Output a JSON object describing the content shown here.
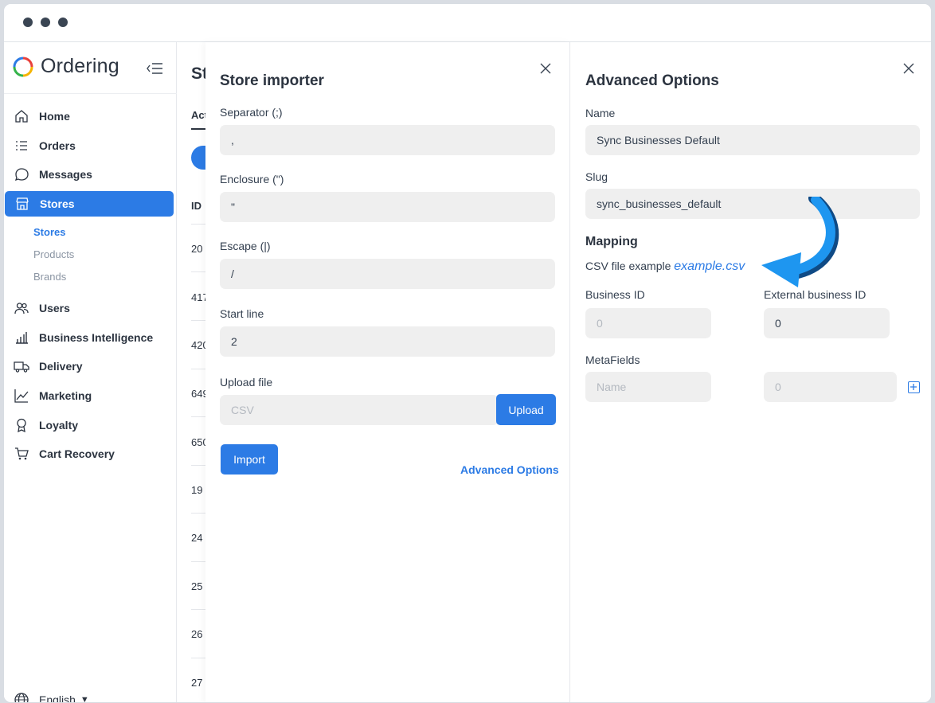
{
  "app": {
    "name": "Ordering"
  },
  "sidebar": {
    "items": [
      {
        "label": "Home",
        "icon": "home-icon"
      },
      {
        "label": "Orders",
        "icon": "list-icon"
      },
      {
        "label": "Messages",
        "icon": "chat-icon"
      },
      {
        "label": "Stores",
        "icon": "store-icon",
        "active": true
      },
      {
        "label": "Users",
        "icon": "users-icon"
      },
      {
        "label": "Business Intelligence",
        "icon": "bar-chart-icon"
      },
      {
        "label": "Delivery",
        "icon": "truck-icon"
      },
      {
        "label": "Marketing",
        "icon": "trend-icon"
      },
      {
        "label": "Loyalty",
        "icon": "award-icon"
      },
      {
        "label": "Cart Recovery",
        "icon": "cart-icon"
      }
    ],
    "subitems": [
      {
        "label": "Stores",
        "active": true
      },
      {
        "label": "Products"
      },
      {
        "label": "Brands"
      }
    ],
    "language": "English"
  },
  "background_list": {
    "title": "St",
    "tab": "Act",
    "id_header": "ID",
    "rows": [
      "20",
      "417",
      "420",
      "649",
      "650",
      "19",
      "24",
      "25",
      "26",
      "27"
    ]
  },
  "store_importer": {
    "title": "Store importer",
    "fields": [
      {
        "label": "Separator (;)",
        "value": ","
      },
      {
        "label": "Enclosure (\")",
        "value": "\""
      },
      {
        "label": "Escape (|)",
        "value": "/"
      },
      {
        "label": "Start line",
        "value": "2"
      }
    ],
    "upload_label": "Upload file",
    "upload_placeholder": "CSV",
    "upload_button": "Upload",
    "import_button": "Import",
    "advanced_link": "Advanced Options"
  },
  "advanced_options": {
    "title": "Advanced Options",
    "name_label": "Name",
    "name_value": "Sync Businesses Default",
    "slug_label": "Slug",
    "slug_value": "sync_businesses_default",
    "mapping_title": "Mapping",
    "csv_example_label": "CSV file example",
    "csv_example_link": "example.csv",
    "business_id_label": "Business ID",
    "business_id_placeholder": "0",
    "external_id_label": "External business ID",
    "external_id_value": "0",
    "metafields_label": "MetaFields",
    "metafield_name_placeholder": "Name",
    "metafield_value_placeholder": "0"
  },
  "colors": {
    "accent": "#2c7be5",
    "arrow": "#1e96f0",
    "arrow_dark": "#0f4a85"
  }
}
